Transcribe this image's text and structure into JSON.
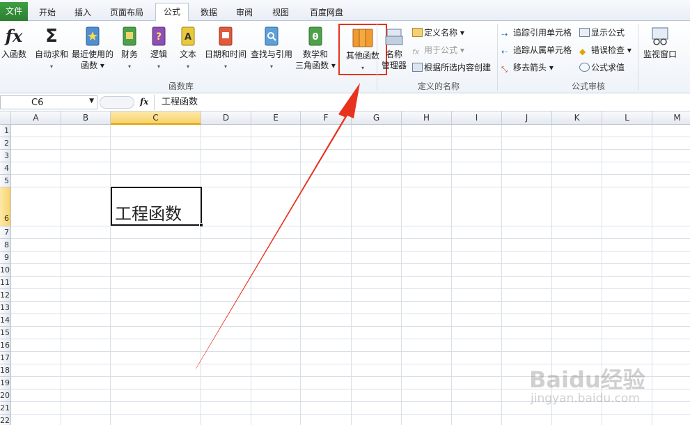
{
  "tabs": [
    "文件",
    "开始",
    "插入",
    "页面布局",
    "公式",
    "数据",
    "审阅",
    "视图",
    "百度网盘"
  ],
  "ribbon": {
    "insert_function": "入函数",
    "autosum": {
      "line1": "自动求和",
      "line2": "▾"
    },
    "recent": {
      "line1": "最近使用的",
      "line2": "函数 ▾"
    },
    "financial": {
      "line1": "财务",
      "line2": "▾"
    },
    "logical": {
      "line1": "逻辑",
      "line2": "▾"
    },
    "text": {
      "line1": "文本",
      "line2": "▾"
    },
    "datetime": {
      "line1": "日期和时间",
      "line2": "▾"
    },
    "lookup": {
      "line1": "查找与引用",
      "line2": "▾"
    },
    "math": {
      "line1": "数学和",
      "line2": "三角函数 ▾"
    },
    "other": {
      "line1": "其他函数",
      "line2": "▾"
    },
    "name_mgr": {
      "line1": "名称",
      "line2": "管理器"
    },
    "define_name": "定义名称 ▾",
    "use_in_formula": "用于公式 ▾",
    "create_from_sel": "根据所选内容创建",
    "trace_precedents": "追踪引用单元格",
    "trace_dependents": "追踪从属单元格",
    "remove_arrows": "移去箭头 ▾",
    "show_formulas": "显示公式",
    "error_check": "错误检查 ▾",
    "evaluate": "公式求值",
    "watch": "监视窗口",
    "groups": {
      "library": "函数库",
      "names": "定义的名称",
      "audit": "公式审核"
    }
  },
  "formula_bar": {
    "name_box": "C6",
    "fx": "fx",
    "content": "工程函数"
  },
  "columns": [
    "A",
    "B",
    "C",
    "D",
    "E",
    "F",
    "G",
    "H",
    "I",
    "J",
    "K",
    "L",
    "M"
  ],
  "rows": [
    "1",
    "2",
    "3",
    "4",
    "5",
    "6",
    "7",
    "8",
    "9",
    "10",
    "11",
    "12",
    "13",
    "14",
    "15",
    "16",
    "17",
    "18",
    "19",
    "20",
    "21",
    "22"
  ],
  "active_cell": {
    "ref": "C6",
    "value": "工程函数"
  },
  "watermark": {
    "brand": "Baidu经验",
    "url": "jingyan.baidu.com"
  },
  "colors": {
    "highlight": "#e8321e",
    "file_tab": "#2f8a35"
  }
}
